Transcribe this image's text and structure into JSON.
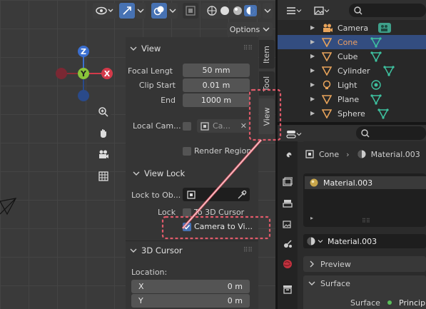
{
  "viewport": {
    "header_options": "Options",
    "gizmo": {
      "z": "Z",
      "y": "Y",
      "x": "X"
    }
  },
  "npanel": {
    "tabs": [
      "Item",
      "Tool",
      "View"
    ],
    "view_section": "View",
    "focal_label": "Focal Lengt",
    "focal_value": "50 mm",
    "clip_start_label": "Clip Start",
    "clip_start_value": "0.01 m",
    "end_label": "End",
    "end_value": "1000 m",
    "local_camera_label": "Local Cam...",
    "camera_field": "Ca...",
    "render_region": "Render Region",
    "view_lock_section": "View Lock",
    "lock_to_object": "Lock to Ob...",
    "lock_label": "Lock",
    "to_3d_cursor": "To 3D Cursor",
    "camera_to_view": "Camera to Vi...",
    "cursor_section": "3D Cursor",
    "location_label": "Location:",
    "x_label": "X",
    "x_value": "0 m",
    "y_label": "Y",
    "y_value": "0 m"
  },
  "outliner": {
    "items": [
      {
        "name": "Camera",
        "selected": false
      },
      {
        "name": "Cone",
        "selected": true
      },
      {
        "name": "Cube",
        "selected": false
      },
      {
        "name": "Cylinder",
        "selected": false
      },
      {
        "name": "Light",
        "selected": false
      },
      {
        "name": "Plane",
        "selected": false
      },
      {
        "name": "Sphere",
        "selected": false
      }
    ]
  },
  "properties": {
    "breadcrumb_object": "Cone",
    "breadcrumb_material": "Material.003",
    "slot_name": "Material.003",
    "material_select": "Material.003",
    "preview": "Preview",
    "surface": "Surface",
    "surface_label": "Surface",
    "surface_value": "Principl"
  },
  "colors": {
    "accent": "#4772b3",
    "annotation": "#e05a6a",
    "selected_row": "#334d80",
    "outliner_text_sel": "#f0a060"
  }
}
